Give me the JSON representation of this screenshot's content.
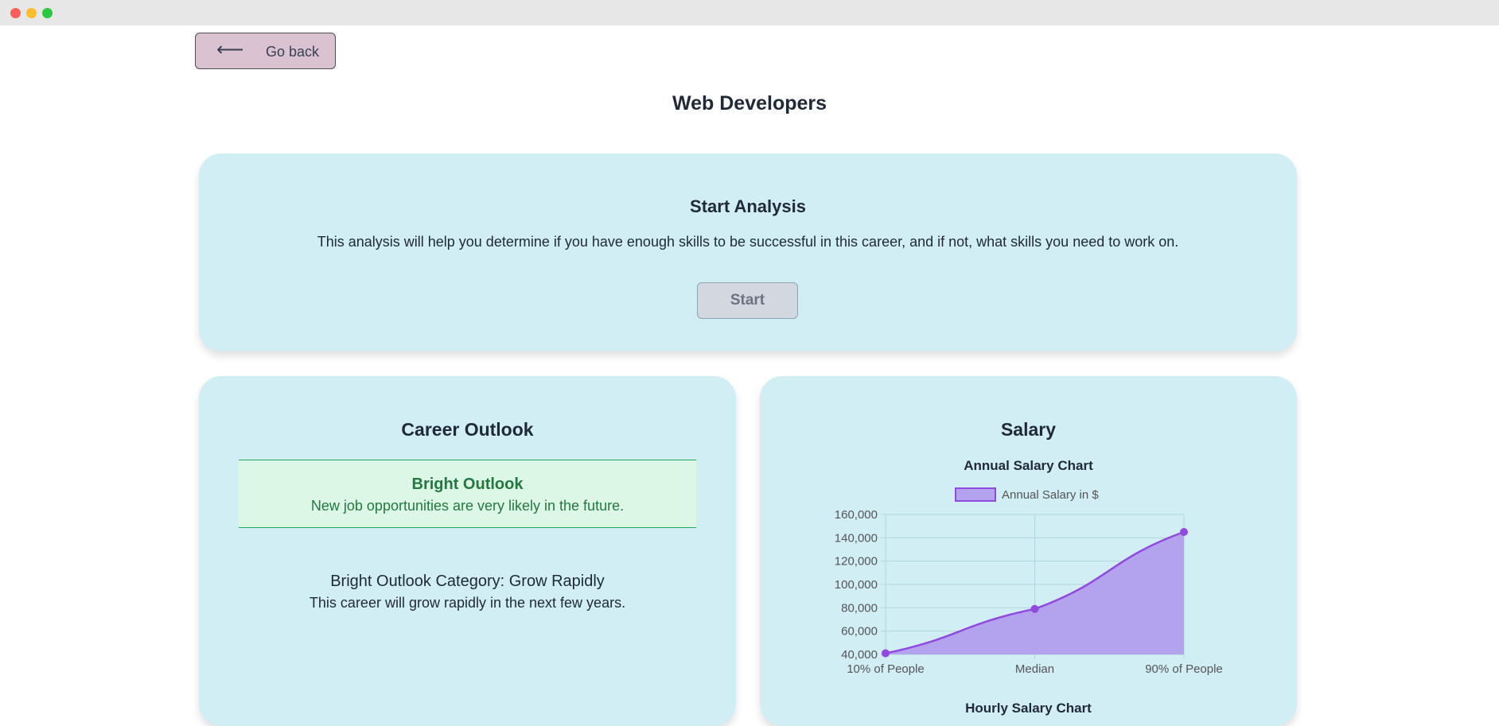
{
  "nav": {
    "back_label": "Go back",
    "back_arrow": "⟵"
  },
  "page": {
    "title": "Web Developers"
  },
  "analysis": {
    "title": "Start Analysis",
    "description": "This analysis will help you determine if you have enough skills to be successful in this career, and if not, what skills you need to work on.",
    "start_label": "Start"
  },
  "outlook": {
    "title": "Career Outlook",
    "badge_title": "Bright Outlook",
    "badge_desc": "New job opportunities are very likely in the future.",
    "category": "Bright Outlook Category: Grow Rapidly",
    "category_desc": "This career will grow rapidly in the next few years."
  },
  "salary": {
    "title": "Salary",
    "chart_title": "Annual Salary Chart",
    "hourly_title": "Hourly Salary Chart"
  },
  "colors": {
    "card_bg": "#d0eef4",
    "series": "#9149e0",
    "series_fill": "#b3a2ee",
    "outlook_green": "#22793f"
  },
  "chart_data": {
    "type": "area",
    "title": "Annual Salary Chart",
    "categories": [
      "10% of People",
      "Median",
      "90% of People"
    ],
    "series": [
      {
        "name": "Annual Salary in $",
        "values": [
          41000,
          79000,
          145000
        ]
      }
    ],
    "y_ticks": [
      "40,000",
      "60,000",
      "80,000",
      "100,000",
      "120,000",
      "140,000",
      "160,000"
    ],
    "ylim": [
      40000,
      160000
    ],
    "legend": "top",
    "grid": true
  }
}
